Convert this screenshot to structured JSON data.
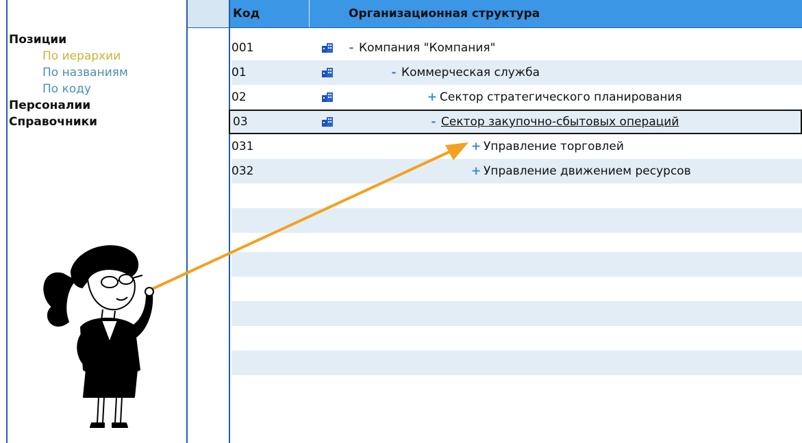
{
  "sidebar": {
    "sections": [
      {
        "label": "Позиции",
        "items": [
          {
            "label": "По иерархии",
            "active": true
          },
          {
            "label": "По названиям",
            "active": false
          },
          {
            "label": "По коду",
            "active": false
          }
        ]
      },
      {
        "label": "Персоналии",
        "items": []
      },
      {
        "label": "Справочники",
        "items": []
      }
    ]
  },
  "grid": {
    "columns": {
      "code": "Код",
      "org": "Организационная структура"
    },
    "rows": [
      {
        "code": "001",
        "toggle": "-",
        "label": "Компания \"Компания\"",
        "icon": "building-icon",
        "level": 0
      },
      {
        "code": "01",
        "toggle": "-",
        "label": "Коммерческая служба",
        "icon": "building-icon",
        "level": 1
      },
      {
        "code": "02",
        "toggle": "+",
        "label": "Сектор стратегического планирования",
        "icon": "building-icon",
        "level": 2
      },
      {
        "code": "03",
        "toggle": "-",
        "label": "Сектор закупочно-сбытовых операций",
        "icon": "building-icon",
        "level": 2,
        "selected": true
      },
      {
        "code": "031",
        "toggle": "+",
        "label": "Управление торговлей",
        "icon": null,
        "level": 3
      },
      {
        "code": "032",
        "toggle": "+",
        "label": "Управление движением ресурсов",
        "icon": null,
        "level": 3
      }
    ]
  },
  "colors": {
    "header_bar": "#3c96e6",
    "frame": "#1d5fa8",
    "row_alt": "#e3edf6",
    "active_nav": "#c8b43a",
    "nav_link": "#4a8fb0",
    "arrow": "#f4a020"
  }
}
